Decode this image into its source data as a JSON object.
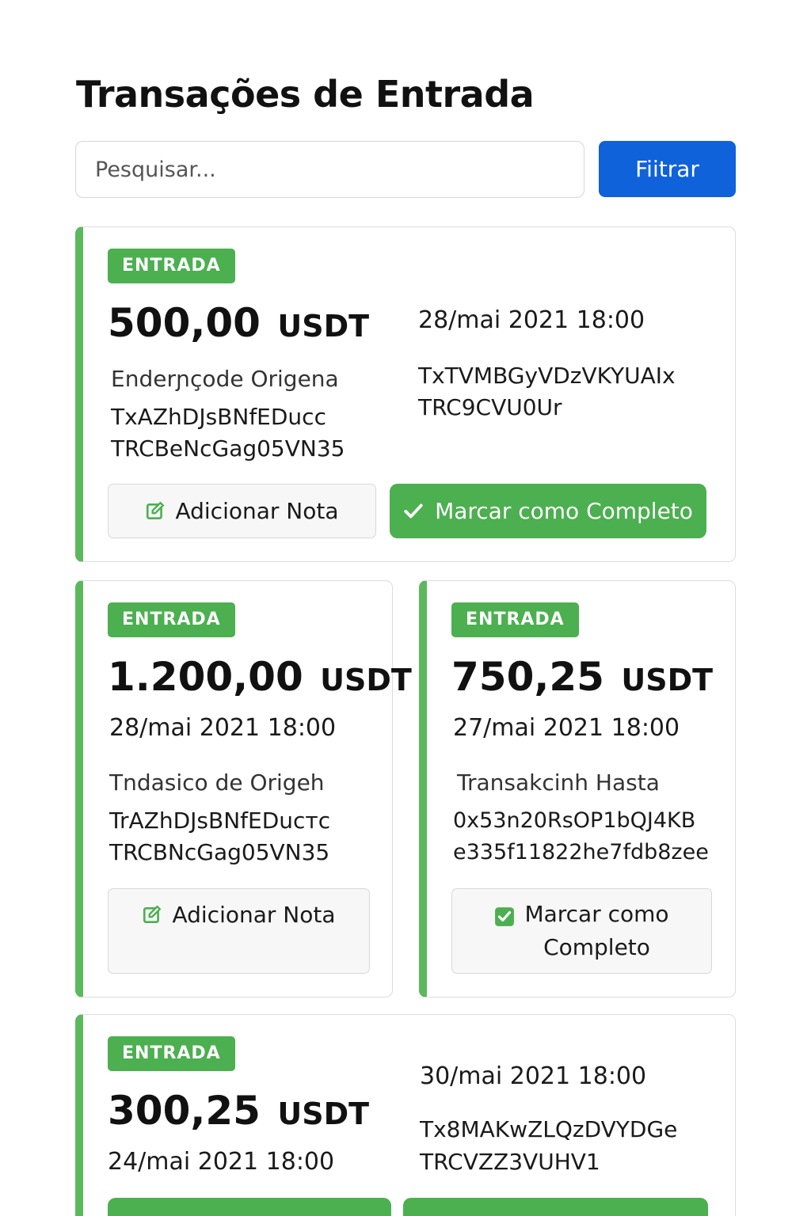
{
  "header": {
    "title": "Transações de Entrada"
  },
  "search": {
    "placeholder": "Pesquisar..."
  },
  "filter": {
    "label": "Fiitrar"
  },
  "colors": {
    "accent": "#4caf50",
    "primary": "#0f62d9",
    "card_border": "#5cb85c"
  },
  "cards": [
    {
      "badge": "ENTRADA",
      "amount": "500,00",
      "currency": "USDT",
      "date": "28/mai 2021 18:00",
      "origin_label": "Enderɲçode Origena",
      "origin_line1": "TxAZhDJsBNfEDucc",
      "origin_line2": "TRCBeNcGag05VN35",
      "tx_line1": "TxTVMBGyVDzVKYUAIx",
      "tx_line2": "TRC9CVU0Ur",
      "note_button": "Adicionar Nota",
      "complete_button": "Marcar como Completo"
    },
    {
      "badge": "ENTRADA",
      "amount": "1.200,00",
      "currency": "USDT",
      "date": "28/mai 2021 18:00",
      "origin_label": "Tndasico de Origeh",
      "origin_line1": "TrAZhDJsBNfEDucтc",
      "origin_line2": "TRCBNcGag05VN35",
      "note_button": "Adicionar Nota"
    },
    {
      "badge": "ENTRADA",
      "amount": "750,25",
      "currency": "USDT",
      "date": "27/mai 2021 18:00",
      "origin_label": "Transakcinh Hasta",
      "origin_line1": "0x53n20RsOP1bQJ4KB",
      "origin_line2": "e335f11822he7fdb8zee",
      "complete_line1": "Marcar como",
      "complete_line2": "Completo"
    },
    {
      "badge": "ENTRADA",
      "amount": "300,25",
      "currency": "USDT",
      "date": "24/mai 2021 18:00",
      "date_right": "30/mai 2021 18:00",
      "tx_line1": "Tx8MAKwZLQzDVYDGe",
      "tx_line2": "TRCVZZ3VUHV1"
    }
  ]
}
